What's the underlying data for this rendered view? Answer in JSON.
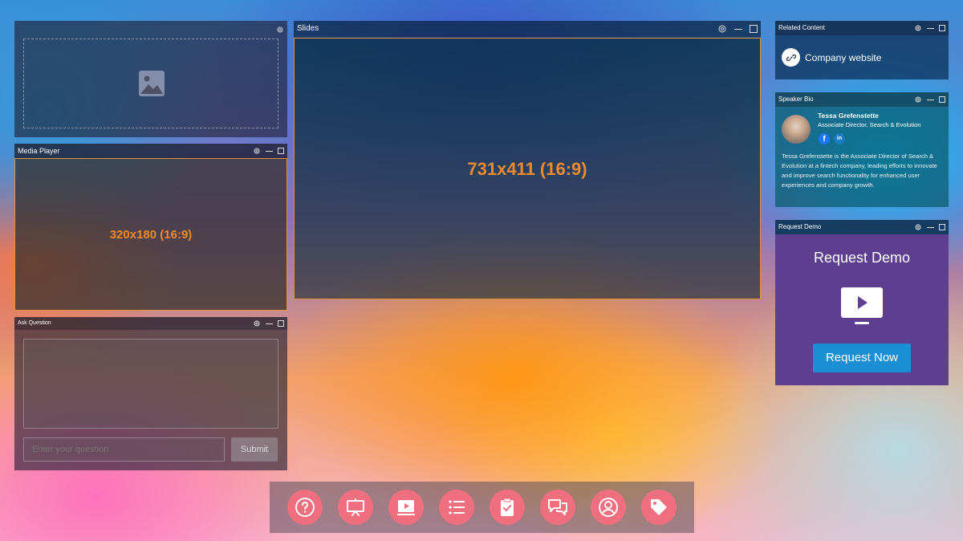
{
  "image_panel": {
    "placeholder_icon": "image-icon"
  },
  "media_player": {
    "title": "Media Player",
    "size_label": "320x180 (16:9)"
  },
  "ask_question": {
    "title": "Ask Question",
    "input_placeholder": "Enter your question",
    "submit_label": "Submit"
  },
  "slides": {
    "title": "Slides",
    "size_label": "731x411 (16:9)"
  },
  "related_content": {
    "title": "Related Content",
    "link_label": "Company website",
    "link_icon": "link-icon"
  },
  "speaker_bio": {
    "title": "Speaker Bio",
    "name": "Tessa Grefenstette",
    "role": "Associate Director, Search & Evolution",
    "bio": "Tessa Grefenstette is the Associate Director of Search & Evolution at a fintech company, leading efforts to innovate and improve search functionality for enhanced user experiences and company growth.",
    "social": [
      "facebook-icon",
      "linkedin-icon"
    ]
  },
  "request_demo": {
    "title": "Request Demo",
    "heading": "Request Demo",
    "button_label": "Request Now",
    "accent": "#5e3f8f",
    "button_color": "#1a8fd6"
  },
  "bottom_bar": {
    "buttons": [
      "help-icon",
      "presentation-icon",
      "video-icon",
      "list-icon",
      "clipboard-check-icon",
      "chat-icon",
      "profile-icon",
      "tag-icon"
    ],
    "color": "#ef6f7f"
  }
}
